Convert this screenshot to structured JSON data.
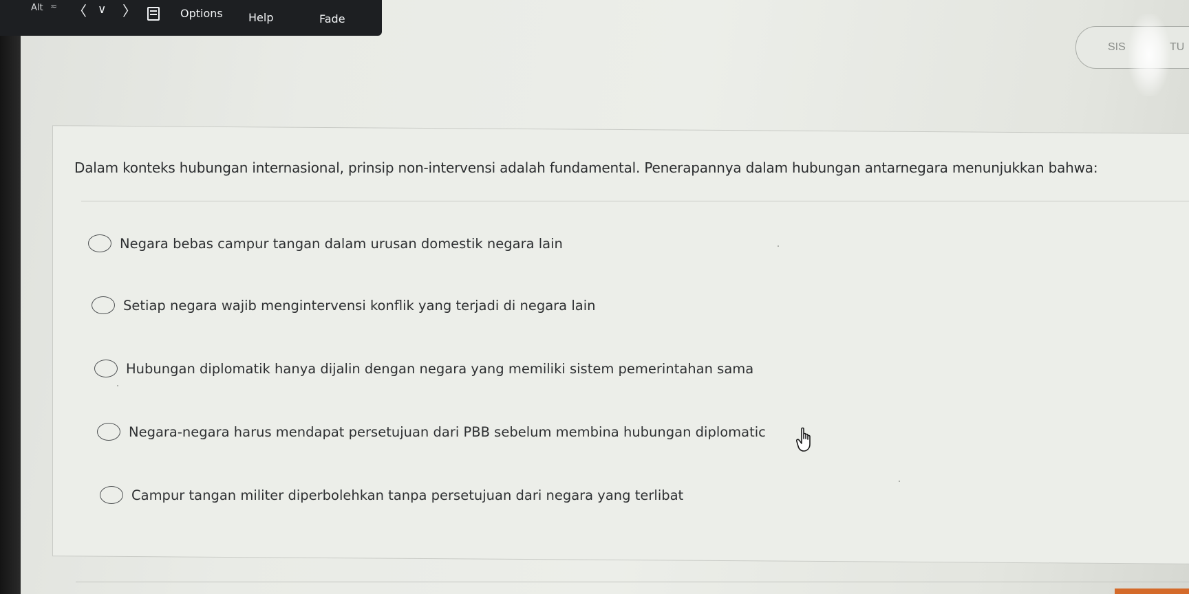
{
  "toolbar": {
    "alt_label": "Alt",
    "tilde": "≈",
    "back": "〈",
    "down": "∨",
    "forward": "〉",
    "options_label": "Options",
    "help_label": "Help",
    "fade_label": "Fade"
  },
  "header": {
    "pill_left_text": "SIS",
    "pill_right_text": "TU"
  },
  "question": {
    "text": "Dalam konteks hubungan internasional, prinsip non-intervensi adalah fundamental. Penerapannya dalam hubungan antarnegara menunjukkan bahwa:"
  },
  "options": [
    {
      "label": "Negara bebas campur tangan dalam urusan domestik negara lain",
      "selected": false
    },
    {
      "label": "Setiap negara wajib mengintervensi konflik yang terjadi di negara lain",
      "selected": false
    },
    {
      "label": "Hubungan diplomatik hanya dijalin dengan negara yang memiliki sistem pemerintahan sama",
      "selected": false
    },
    {
      "label": "Negara-negara harus mendapat persetujuan dari PBB sebelum membina hubungan diplomatic",
      "selected": false
    },
    {
      "label": "Campur tangan militer diperbolehkan tanpa persetujuan dari negara yang terlibat",
      "selected": false
    }
  ],
  "icons": {
    "cursor": "hand-pointer-icon"
  },
  "colors": {
    "toolbar_bg": "#1d1f22",
    "text": "#2e3032",
    "accent_bottom": "#d46a2a"
  }
}
